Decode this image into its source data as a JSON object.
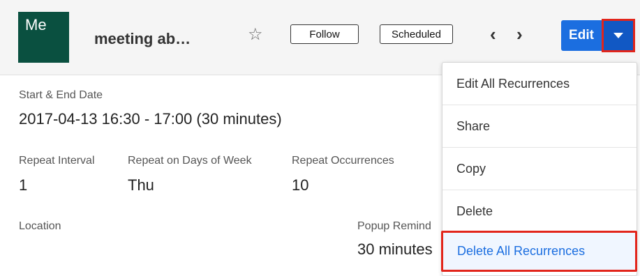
{
  "header": {
    "avatar_text": "Me",
    "record_name": "meeting ab…",
    "follow_label": "Follow",
    "status_label": "Scheduled",
    "edit_label": "Edit",
    "icons": {
      "favorite": "star-outline-icon",
      "previous": "chevron-left-icon",
      "next": "chevron-right-icon",
      "actions": "caret-down-icon"
    },
    "colors": {
      "avatar": "#0a5040",
      "primary": "#1b6ee0",
      "highlight": "#e2251b"
    }
  },
  "fields": {
    "start_end": {
      "label": "Start & End Date",
      "value": "2017-04-13 16:30 - 17:00 (30 minutes)"
    },
    "repeat_interval": {
      "label": "Repeat Interval",
      "value": "1"
    },
    "repeat_days": {
      "label": "Repeat on Days of Week",
      "value": "Thu"
    },
    "repeat_occurrences": {
      "label": "Repeat Occurrences",
      "value": "10"
    },
    "location": {
      "label": "Location"
    },
    "popup_reminder": {
      "label": "Popup Remind",
      "value": "30 minutes"
    }
  },
  "actions_menu": {
    "items": [
      {
        "label": "Edit All Recurrences"
      },
      {
        "label": "Share"
      },
      {
        "label": "Copy"
      },
      {
        "label": "Delete"
      },
      {
        "label": "Delete All Recurrences",
        "highlighted": true
      }
    ]
  }
}
